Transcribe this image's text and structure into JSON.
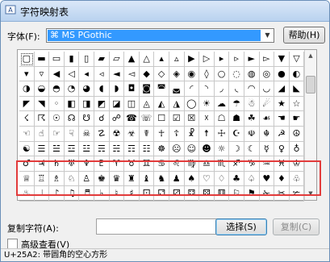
{
  "window": {
    "title": "字符映射表"
  },
  "font": {
    "label": "字体(F):",
    "selected": "MS PGothic",
    "help_label": "帮助(H)"
  },
  "grid": {
    "rows": [
      [
        "▢",
        "▬",
        "▭",
        "▮",
        "▯",
        "▰",
        "▱",
        "▲",
        "△",
        "▴",
        "▵",
        "▶",
        "▷",
        "▸",
        "▹",
        "►",
        "▻",
        "▼",
        "▽"
      ],
      [
        "▾",
        "▿",
        "◀",
        "◁",
        "◂",
        "◃",
        "◄",
        "◅",
        "◆",
        "◇",
        "◈",
        "◉",
        "◊",
        "○",
        "◌",
        "◍",
        "◎",
        "●",
        "◐"
      ],
      [
        "◑",
        "◒",
        "◓",
        "◔",
        "◕",
        "◖",
        "◗",
        "◘",
        "◙",
        "◚",
        "◛",
        "◜",
        "◝",
        "◞",
        "◟",
        "◠",
        "◡",
        "◢",
        "◣"
      ],
      [
        "◤",
        "◥",
        "◦",
        "◧",
        "◨",
        "◩",
        "◪",
        "◫",
        "◬",
        "◭",
        "◮",
        "◯",
        "☀",
        "☁",
        "☂",
        "☃",
        "☄",
        "★",
        "☆"
      ],
      [
        "☇",
        "☈",
        "☉",
        "☊",
        "☋",
        "☌",
        "☍",
        "☎",
        "☏",
        "☐",
        "☑",
        "☒",
        "☓",
        "☖",
        "☗",
        "☘",
        "☙",
        "☚",
        "☛"
      ],
      [
        "☜",
        "☝",
        "☞",
        "☟",
        "☠",
        "☡",
        "☢",
        "☣",
        "☤",
        "☥",
        "☦",
        "☧",
        "☨",
        "☩",
        "☪",
        "☫",
        "☬",
        "☭",
        "☮"
      ],
      [
        "☯",
        "☰",
        "☱",
        "☲",
        "☳",
        "☴",
        "☵",
        "☶",
        "☷",
        "☸",
        "☹",
        "☺",
        "☻",
        "☼",
        "☽",
        "☾",
        "☿",
        "♀",
        "♁"
      ],
      [
        "♂",
        "♃",
        "♄",
        "♅",
        "♆",
        "♇",
        "♈",
        "♉",
        "♊",
        "♋",
        "♌",
        "♍",
        "♎",
        "♏",
        "♐",
        "♑",
        "♒",
        "♓",
        "♔"
      ],
      [
        "♕",
        "♖",
        "♗",
        "♘",
        "♙",
        "♚",
        "♛",
        "♜",
        "♝",
        "♞",
        "♟",
        "♠",
        "♡",
        "♢",
        "♣",
        "♤",
        "♥",
        "♦",
        "♧"
      ],
      [
        "♨",
        "♩",
        "♪",
        "♫",
        "♬",
        "♭",
        "♮",
        "♯",
        "⚀",
        "⚁",
        "⚂",
        "⚃",
        "⚄",
        "⚅",
        "⚐",
        "⚑",
        "✁",
        "✂",
        "✃"
      ]
    ],
    "selected_char": "▢"
  },
  "copy": {
    "label": "复制字符(A):",
    "value": "",
    "select_label": "选择(S)",
    "copy_label": "复制(C)"
  },
  "advanced": {
    "label": "高级查看(V)"
  },
  "status": {
    "text": "U+25A2: 带圆角的空心方形"
  },
  "colors": {
    "highlight": "#e23b3b",
    "selection": "#3399ff"
  }
}
